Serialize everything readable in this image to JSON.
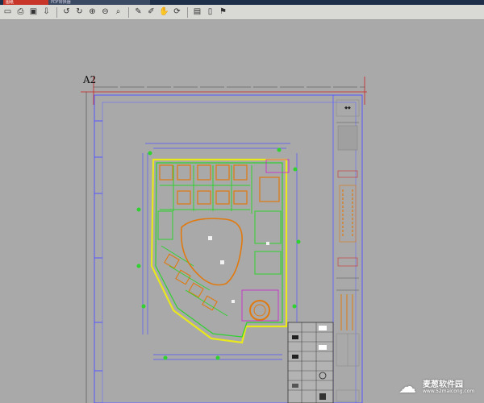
{
  "window": {
    "active_tab": "图纸",
    "other_tab": "PDF转换器"
  },
  "toolbar": {
    "icons": [
      "open-icon",
      "print-icon",
      "save-icon",
      "export-icon",
      "rotate-left-icon",
      "rotate-right-icon",
      "zoom-in-icon",
      "zoom-out-icon",
      "zoom-fit-icon",
      "pen-icon",
      "marker-icon",
      "pan-icon",
      "refresh-icon",
      "layers-icon",
      "page-icon",
      "bookmark-icon"
    ]
  },
  "drawing": {
    "sheet_size_label": "A2"
  },
  "watermark": {
    "name": "麦葱软件园",
    "url": "www.52maicong.com"
  },
  "colors": {
    "canvas": "#a9a9a9",
    "green_lines": "#2fd22f",
    "yellow_lines": "#e8e81c",
    "orange_lines": "#e07a10",
    "blue_lines": "#5555ff",
    "red_lines": "#cc2222"
  }
}
